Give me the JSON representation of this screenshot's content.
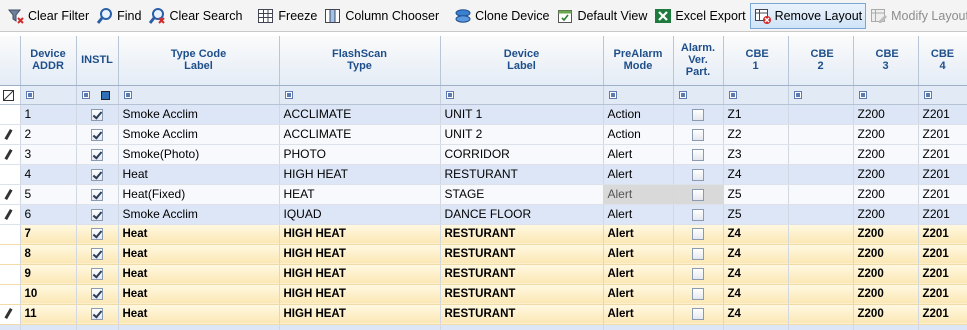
{
  "toolbar": {
    "clear_filter": "Clear Filter",
    "find": "Find",
    "clear_search": "Clear Search",
    "freeze": "Freeze",
    "column_chooser": "Column Chooser",
    "clone_device": "Clone Device",
    "default_view": "Default View",
    "excel_export": "Excel Export",
    "remove_layout": "Remove Layout",
    "modify_layout": "Modify Layout"
  },
  "columns": {
    "device_addr": "Device ADDR",
    "instl": "INSTL",
    "type_code": "Type Code Label",
    "flashscan": "FlashScan Type",
    "device_label": "Device Label",
    "prealarm": "PreAlarm Mode",
    "alarm_ver": "Alarm. Ver. Part.",
    "cbe1": "CBE 1",
    "cbe2": "CBE 2",
    "cbe3": "CBE 3",
    "cbe4": "CBE 4"
  },
  "rows": [
    {
      "addr": "1",
      "type": "Smoke Acclim",
      "flash": "ACCLIMATE",
      "label": "UNIT 1",
      "prealarm": "Action",
      "cbe1": "Z1",
      "cbe2": "",
      "cbe3": "Z200",
      "cbe4": "Z201"
    },
    {
      "addr": "2",
      "type": "Smoke Acclim",
      "flash": "ACCLIMATE",
      "label": "UNIT 2",
      "prealarm": "Action",
      "cbe1": "Z2",
      "cbe2": "",
      "cbe3": "Z200",
      "cbe4": "Z201"
    },
    {
      "addr": "3",
      "type": "Smoke(Photo)",
      "flash": "PHOTO",
      "label": "CORRIDOR",
      "prealarm": "Alert",
      "cbe1": "Z3",
      "cbe2": "",
      "cbe3": "Z200",
      "cbe4": "Z201"
    },
    {
      "addr": "4",
      "type": "Heat",
      "flash": "HIGH HEAT",
      "label": "RESTURANT",
      "prealarm": "Alert",
      "cbe1": "Z4",
      "cbe2": "",
      "cbe3": "Z200",
      "cbe4": "Z201"
    },
    {
      "addr": "5",
      "type": "Heat(Fixed)",
      "flash": "HEAT",
      "label": "STAGE",
      "prealarm": "Alert",
      "cbe1": "Z5",
      "cbe2": "",
      "cbe3": "Z200",
      "cbe4": "Z201"
    },
    {
      "addr": "6",
      "type": "Smoke Acclim",
      "flash": "IQUAD",
      "label": "DANCE FLOOR",
      "prealarm": "Alert",
      "cbe1": "Z5",
      "cbe2": "",
      "cbe3": "Z200",
      "cbe4": "Z201"
    },
    {
      "addr": "7",
      "type": "Heat",
      "flash": "HIGH HEAT",
      "label": "RESTURANT",
      "prealarm": "Alert",
      "cbe1": "Z4",
      "cbe2": "",
      "cbe3": "Z200",
      "cbe4": "Z201"
    },
    {
      "addr": "8",
      "type": "Heat",
      "flash": "HIGH HEAT",
      "label": "RESTURANT",
      "prealarm": "Alert",
      "cbe1": "Z4",
      "cbe2": "",
      "cbe3": "Z200",
      "cbe4": "Z201"
    },
    {
      "addr": "9",
      "type": "Heat",
      "flash": "HIGH HEAT",
      "label": "RESTURANT",
      "prealarm": "Alert",
      "cbe1": "Z4",
      "cbe2": "",
      "cbe3": "Z200",
      "cbe4": "Z201"
    },
    {
      "addr": "10",
      "type": "Heat",
      "flash": "HIGH HEAT",
      "label": "RESTURANT",
      "prealarm": "Alert",
      "cbe1": "Z4",
      "cbe2": "",
      "cbe3": "Z200",
      "cbe4": "Z201"
    },
    {
      "addr": "11",
      "type": "Heat",
      "flash": "HIGH HEAT",
      "label": "RESTURANT",
      "prealarm": "Alert",
      "cbe1": "Z4",
      "cbe2": "",
      "cbe3": "Z200",
      "cbe4": "Z201"
    }
  ]
}
